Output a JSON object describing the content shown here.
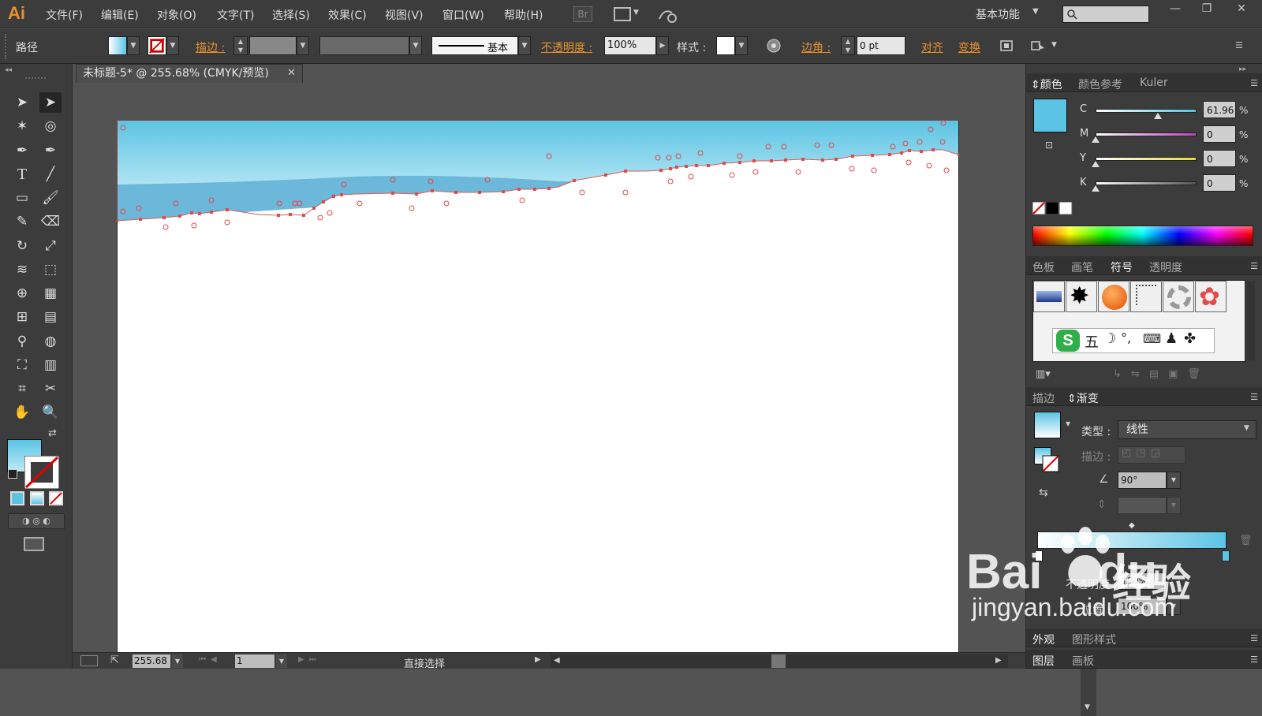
{
  "app": {
    "logo": "Ai"
  },
  "menu": [
    "文件(F)",
    "编辑(E)",
    "对象(O)",
    "文字(T)",
    "选择(S)",
    "效果(C)",
    "视图(V)",
    "窗口(W)",
    "帮助(H)"
  ],
  "menubar": {
    "bridge": "Br",
    "workspace": "基本功能"
  },
  "control": {
    "object_type": "路径",
    "stroke_label": "描边 :",
    "stroke_style": "基本",
    "opacity_label": "不透明度 :",
    "opacity": "100%",
    "style_label": "样式 :",
    "corner_label": "边角 :",
    "corner_value": "0 pt",
    "align_label": "对齐",
    "transform_label": "变换"
  },
  "document": {
    "tab_title": "未标题-5* @ 255.68% (CMYK/预览)"
  },
  "status": {
    "zoom": "255.68",
    "page": "1",
    "tool": "直接选择"
  },
  "color_panel": {
    "tabs": [
      "颜色",
      "颜色参考",
      "Kuler"
    ],
    "channels": [
      {
        "label": "C",
        "value": "61.96",
        "fraction": 0.62,
        "color": "#4ac8e8"
      },
      {
        "label": "M",
        "value": "0",
        "fraction": 0,
        "color": "#c040c0"
      },
      {
        "label": "Y",
        "value": "0",
        "fraction": 0,
        "color": "#e8e030"
      },
      {
        "label": "K",
        "value": "0",
        "fraction": 0,
        "color": "#555555"
      }
    ],
    "pct": "%",
    "fill_color": "#5bc4e4"
  },
  "symbols_panel": {
    "tabs": [
      "色板",
      "画笔",
      "符号",
      "透明度"
    ],
    "ime_chars": "五"
  },
  "gradient_panel": {
    "tabs": [
      "描边",
      "渐变"
    ],
    "type_label": "类型 :",
    "type_value": "线性",
    "stroke_label": "描边 :",
    "angle": "90°",
    "opacity_label": "不透明度 :",
    "opacity_value": "100%",
    "location_label": "位置 :",
    "location_value": "100%"
  },
  "bottom_panels": {
    "row1": [
      "外观",
      "图形样式"
    ],
    "row2": [
      "图层",
      "画板"
    ]
  },
  "watermark": {
    "main": "Bai",
    "du": "du",
    "cn": "经验",
    "url": "jingyan.baidu.com"
  },
  "colors": {
    "accent": "#e8912d",
    "sky_top": "#5bc4e4",
    "sky_mid": "#a8e0f2",
    "water": "#6bb8da",
    "anchor": "#e04a4a"
  }
}
